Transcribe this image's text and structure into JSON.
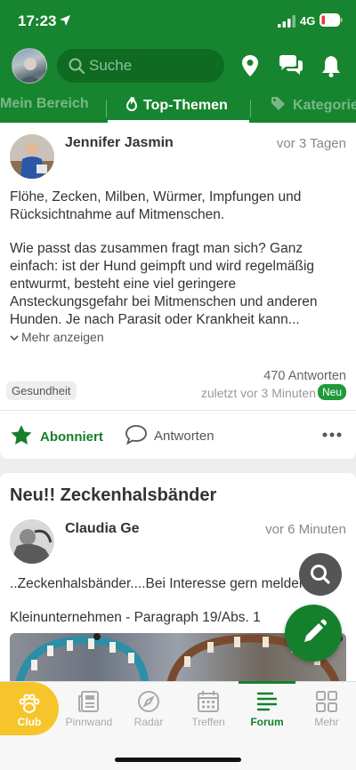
{
  "status": {
    "time": "17:23",
    "network": "4G"
  },
  "search": {
    "placeholder": "Suche"
  },
  "tabs": [
    {
      "label": "Mein Bereich"
    },
    {
      "label": "Top-Themen"
    },
    {
      "label": "Kategorie"
    }
  ],
  "post1": {
    "author": "Jennifer Jasmin",
    "time": "vor 3 Tagen",
    "para1": "Flöhe, Zecken, Milben, Würmer, Impfungen und Rücksichtnahme auf Mitmenschen.",
    "para2": "Wie passt das zusammen fragt man sich? Ganz einfach: ist der Hund geimpft und wird regelmäßig entwurmt, besteht eine viel geringere Ansteckungsgefahr bei Mitmenschen und anderen Hunden. Je nach Parasit oder Krankheit kann...",
    "more": "Mehr anzeigen",
    "answers": "470 Antworten",
    "last_reply": "zuletzt vor 3 Minuten",
    "new_badge": "Neu",
    "tag": "Gesundheit",
    "subscribe_label": "Abonniert",
    "reply_label": "Antworten"
  },
  "post2": {
    "title": "Neu!! Zeckenhalsbänder",
    "author": "Claudia Ge",
    "time": "vor 6 Minuten",
    "line1": "..Zeckenhalsbänder....Bei Interesse gern melden",
    "line2": "Kleinunternehmen - Paragraph 19/Abs. 1"
  },
  "bottomnav": [
    {
      "label": "Club"
    },
    {
      "label": "Pinnwand"
    },
    {
      "label": "Radar"
    },
    {
      "label": "Treffen"
    },
    {
      "label": "Forum"
    },
    {
      "label": "Mehr"
    }
  ],
  "colors": {
    "brand_green": "#17852f",
    "club_yellow": "#f6c52b",
    "new_badge": "#1f9a3a"
  }
}
